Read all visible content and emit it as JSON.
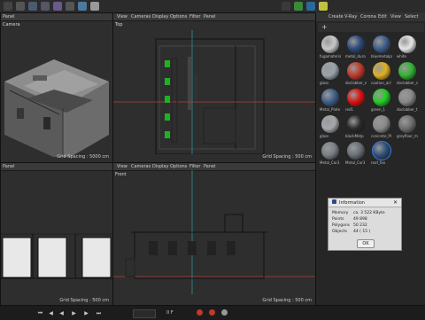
{
  "top_right_viewport": {
    "menu": [
      "View",
      "Cameras",
      "Display",
      "Options",
      "Filter",
      "Panel"
    ],
    "name": "Top",
    "grid": "Grid Spacing : 500 cm"
  },
  "top_left_viewport": {
    "menu": [
      "Panel"
    ],
    "name": "Camera",
    "grid": "Grid Spacing : 5000 cm"
  },
  "bottom_left_viewport": {
    "menu": [
      "Panel"
    ],
    "grid": "Grid Spacing : 500 cm"
  },
  "bottom_right_viewport": {
    "menu": [
      "View",
      "Cameras",
      "Display",
      "Options",
      "Filter",
      "Panel"
    ],
    "name": "Front",
    "grid": "Grid Spacing : 500 cm"
  },
  "material_panel": {
    "menu": [
      "Create",
      "V-Ray",
      "Corona",
      "Edit",
      "View",
      "Select"
    ],
    "materials": [
      {
        "label": "fugamaterial",
        "color": "#c9c9c9"
      },
      {
        "label": "metal_dura",
        "color": "#2c4a7a"
      },
      {
        "label": "bluemetalpa",
        "color": "#3d5c8a"
      },
      {
        "label": "white",
        "color": "#e6e6e6"
      },
      {
        "label": "glass",
        "color": "#9aa3ad"
      },
      {
        "label": "doclabber_n",
        "color": "#c0392b"
      },
      {
        "label": "caution_acl",
        "color": "#e0b020"
      },
      {
        "label": "doclabber_s",
        "color": "#32b432"
      },
      {
        "label": "Metal_Plate",
        "color": "#3f5f88"
      },
      {
        "label": "red1",
        "color": "#e01010"
      },
      {
        "label": "green_1",
        "color": "#22cc22"
      },
      {
        "label": "doclabber_t",
        "color": "#888888"
      },
      {
        "label": "glass",
        "color": "#a4a8ad"
      },
      {
        "label": "blackMetp",
        "color": "#2a2a2a"
      },
      {
        "label": "concrete_PI",
        "color": "#8a8a8a"
      },
      {
        "label": "greyfloor_m",
        "color": "#6e6e6e"
      },
      {
        "label": "Metal_Cor3",
        "color": "#7a7f86"
      },
      {
        "label": "Metal_Cor3",
        "color": "#6a7078"
      },
      {
        "label": "roof_fan",
        "color": "#2f4f7a"
      }
    ]
  },
  "info_dialog": {
    "title": "Information",
    "rows": [
      {
        "label": "Memory",
        "value": "ca. 3 522 KByte"
      },
      {
        "label": "Points",
        "value": "49 898"
      },
      {
        "label": "Polygons",
        "value": "50 232"
      },
      {
        "label": "Objects",
        "value": "44 ( 15 )"
      }
    ],
    "ok_label": "OK"
  },
  "timeline": {
    "frame": "0 F"
  }
}
